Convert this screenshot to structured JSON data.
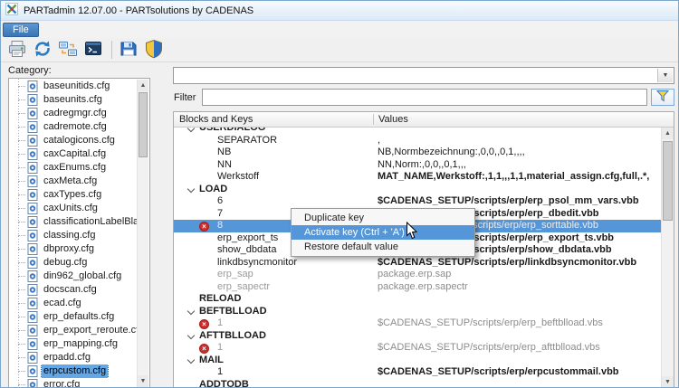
{
  "window": {
    "title": "PARTadmin 12.07.00 - PARTsolutions by CADENAS"
  },
  "menubar": {
    "items": [
      {
        "label": "File"
      }
    ]
  },
  "toolbar": {
    "icons": [
      "printer-icon",
      "refresh-icon",
      "transfer-icon",
      "console-icon",
      "save-icon",
      "shield-icon"
    ]
  },
  "sidebar": {
    "label": "Category:",
    "selected_index": 21,
    "items": [
      "baseunitids.cfg",
      "baseunits.cfg",
      "cadregmgr.cfg",
      "cadremote.cfg",
      "catalogicons.cfg",
      "caxCapital.cfg",
      "caxEnums.cfg",
      "caxMeta.cfg",
      "caxTypes.cfg",
      "caxUnits.cfg",
      "classificationLabelBlackl",
      "classing.cfg",
      "dbproxy.cfg",
      "debug.cfg",
      "din962_global.cfg",
      "docscan.cfg",
      "ecad.cfg",
      "erp_defaults.cfg",
      "erp_export_reroute.cfg",
      "erp_mapping.cfg",
      "erpadd.cfg",
      "erpcustom.cfg",
      "error.cfg"
    ]
  },
  "main": {
    "combo": {
      "value": ""
    },
    "filter": {
      "label": "Filter",
      "value": ""
    },
    "table": {
      "columns": [
        "Blocks and Keys",
        "Values"
      ],
      "rows": [
        {
          "type": "section",
          "label": "USERDIALOG",
          "chevron": true
        },
        {
          "type": "key",
          "key": "SEPARATOR",
          "value": ","
        },
        {
          "type": "key",
          "key": "NB",
          "value": "NB,Normbezeichnung:,0,0,,0,1,,,,"
        },
        {
          "type": "key",
          "key": "NN",
          "value": "NN,Norm:,0,0,,0,1,,,"
        },
        {
          "type": "key",
          "key": "Werkstoff",
          "value": "MAT_NAME,Werkstoff:,1,1,,,1,1,material_assign.cfg,full,.*,",
          "value_bold": true
        },
        {
          "type": "section",
          "label": "LOAD",
          "chevron": true
        },
        {
          "type": "key",
          "key": "6",
          "value": "$CADENAS_SETUP/scripts/erp/erp_psol_mm_vars.vbb",
          "value_bold": true
        },
        {
          "type": "key",
          "key": "7",
          "value": "$CADENAS_SETUP/scripts/erp/erp_dbedit.vbb",
          "value_bold": true
        },
        {
          "type": "key",
          "key": "8",
          "value": "$CADENAS_SETUP/scripts/erp/erp_sorttable.vbb",
          "deactivated": true,
          "key_muted": true,
          "value_muted": true,
          "selected": true
        },
        {
          "type": "key",
          "key": "erp_export_ts",
          "value": "$CADENAS_SETUP/scripts/erp/erp_export_ts.vbb",
          "value_bold": true
        },
        {
          "type": "key",
          "key": "show_dbdata",
          "value": "$CADENAS_SETUP/scripts/erp/show_dbdata.vbb",
          "value_bold": true
        },
        {
          "type": "key",
          "key": "linkdbsyncmonitor",
          "value": "$CADENAS_SETUP/scripts/erp/linkdbsyncmonitor.vbb",
          "value_bold": true
        },
        {
          "type": "key",
          "key": "erp_sap",
          "value": "package.erp.sap",
          "key_muted": true,
          "value_muted": true
        },
        {
          "type": "key",
          "key": "erp_sapectr",
          "value": "package.erp.sapectr",
          "key_muted": true,
          "value_muted": true
        },
        {
          "type": "section",
          "label": "RELOAD"
        },
        {
          "type": "section",
          "label": "BEFTBLLOAD",
          "chevron": true
        },
        {
          "type": "key",
          "key": "1",
          "value": "$CADENAS_SETUP/scripts/erp/erp_beftblload.vbs",
          "deactivated": true,
          "key_muted": true,
          "value_muted": true
        },
        {
          "type": "section",
          "label": "AFTTBLLOAD",
          "chevron": true
        },
        {
          "type": "key",
          "key": "1",
          "value": "$CADENAS_SETUP/scripts/erp/erp_afttblload.vbs",
          "deactivated": true,
          "key_muted": true,
          "value_muted": true
        },
        {
          "type": "section",
          "label": "MAIL",
          "chevron": true
        },
        {
          "type": "key",
          "key": "1",
          "value": "$CADENAS_SETUP/scripts/erp/erpcustommail.vbb",
          "value_bold": true
        },
        {
          "type": "section",
          "label": "ADDTODB"
        }
      ]
    }
  },
  "context_menu": {
    "items": [
      {
        "label": "Duplicate key"
      },
      {
        "label": "Activate key (Ctrl + 'A')",
        "highlighted": true
      },
      {
        "label": "Restore default value"
      }
    ]
  },
  "colors": {
    "selection_blue": "#5596d8",
    "tree_selection_blue": "#62a8e8",
    "deactivated_red": "#d22d2d",
    "menu_item_blue": "#4a86c8"
  }
}
